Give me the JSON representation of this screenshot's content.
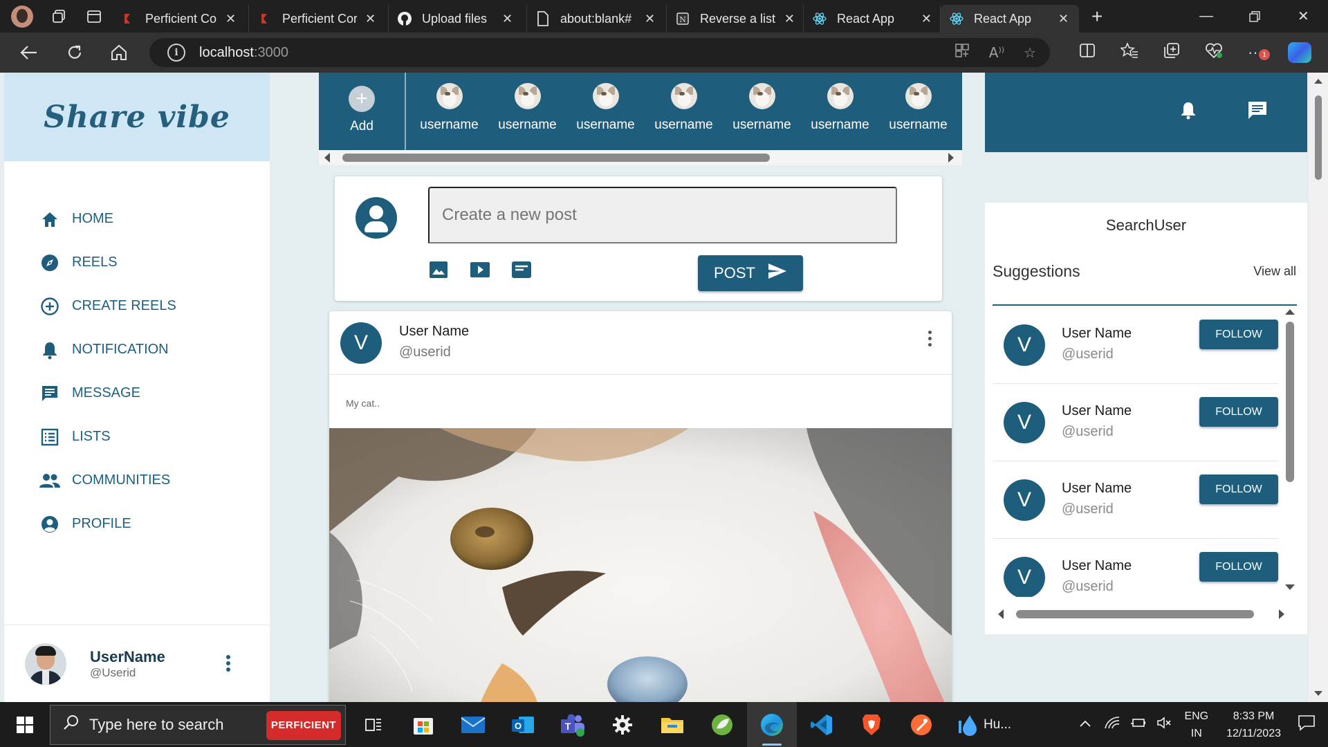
{
  "browser": {
    "tabs": [
      {
        "title": "Perficient Cor",
        "icon": "perficient-tab-icon",
        "active": false
      },
      {
        "title": "Perficient Cor",
        "icon": "perficient-tab-icon",
        "active": false
      },
      {
        "title": "Upload files",
        "icon": "github-icon",
        "active": false
      },
      {
        "title": "about:blank#",
        "icon": "document-icon",
        "active": false
      },
      {
        "title": "Reverse a list",
        "icon": "notion-icon",
        "active": false
      },
      {
        "title": "React App",
        "icon": "react-icon",
        "active": false
      },
      {
        "title": "React App",
        "icon": "react-icon",
        "active": true
      }
    ],
    "url_host": "localhost",
    "url_port": ":3000",
    "extensions_badge": "1"
  },
  "sidebar": {
    "brand": "Share vibe",
    "items": [
      {
        "label": "HOME",
        "icon": "home-icon"
      },
      {
        "label": "REELS",
        "icon": "explore-icon"
      },
      {
        "label": "CREATE REELS",
        "icon": "add-circle-icon"
      },
      {
        "label": "NOTIFICATION",
        "icon": "bell-icon"
      },
      {
        "label": "MESSAGE",
        "icon": "message-icon"
      },
      {
        "label": "LISTS",
        "icon": "list-icon"
      },
      {
        "label": "COMMUNITIES",
        "icon": "people-icon"
      },
      {
        "label": "PROFILE",
        "icon": "account-icon"
      }
    ],
    "user": {
      "name": "UserName",
      "id": "@Userid"
    }
  },
  "stories": {
    "add_label": "Add",
    "items": [
      "username",
      "username",
      "username",
      "username",
      "username",
      "username",
      "username"
    ]
  },
  "create_post": {
    "placeholder": "Create a new post",
    "post_label": "POST"
  },
  "feed": {
    "post": {
      "avatar_letter": "V",
      "name": "User Name",
      "userid": "@userid",
      "caption": "My cat.."
    }
  },
  "right": {
    "search_label": "SearchUser",
    "suggestions_title": "Suggestions",
    "view_all": "View all",
    "suggestions": [
      {
        "avatar": "V",
        "name": "User Name",
        "userid": "@userid",
        "follow": "FOLLOW"
      },
      {
        "avatar": "V",
        "name": "User Name",
        "userid": "@userid",
        "follow": "FOLLOW"
      },
      {
        "avatar": "V",
        "name": "User Name",
        "userid": "@userid",
        "follow": "FOLLOW"
      },
      {
        "avatar": "V",
        "name": "User Name",
        "userid": "@userid",
        "follow": "FOLLOW"
      }
    ]
  },
  "taskbar": {
    "search_placeholder": "Type here to search",
    "search_badge": "PERFICIENT",
    "weather_label": "Hu...",
    "lang_line1": "ENG",
    "lang_line2": "IN",
    "time": "8:33 PM",
    "date": "12/11/2023"
  },
  "colors": {
    "primary": "#1f5d7d",
    "brand_bg": "#cfe6f5",
    "page_bg": "#e4eef0"
  }
}
